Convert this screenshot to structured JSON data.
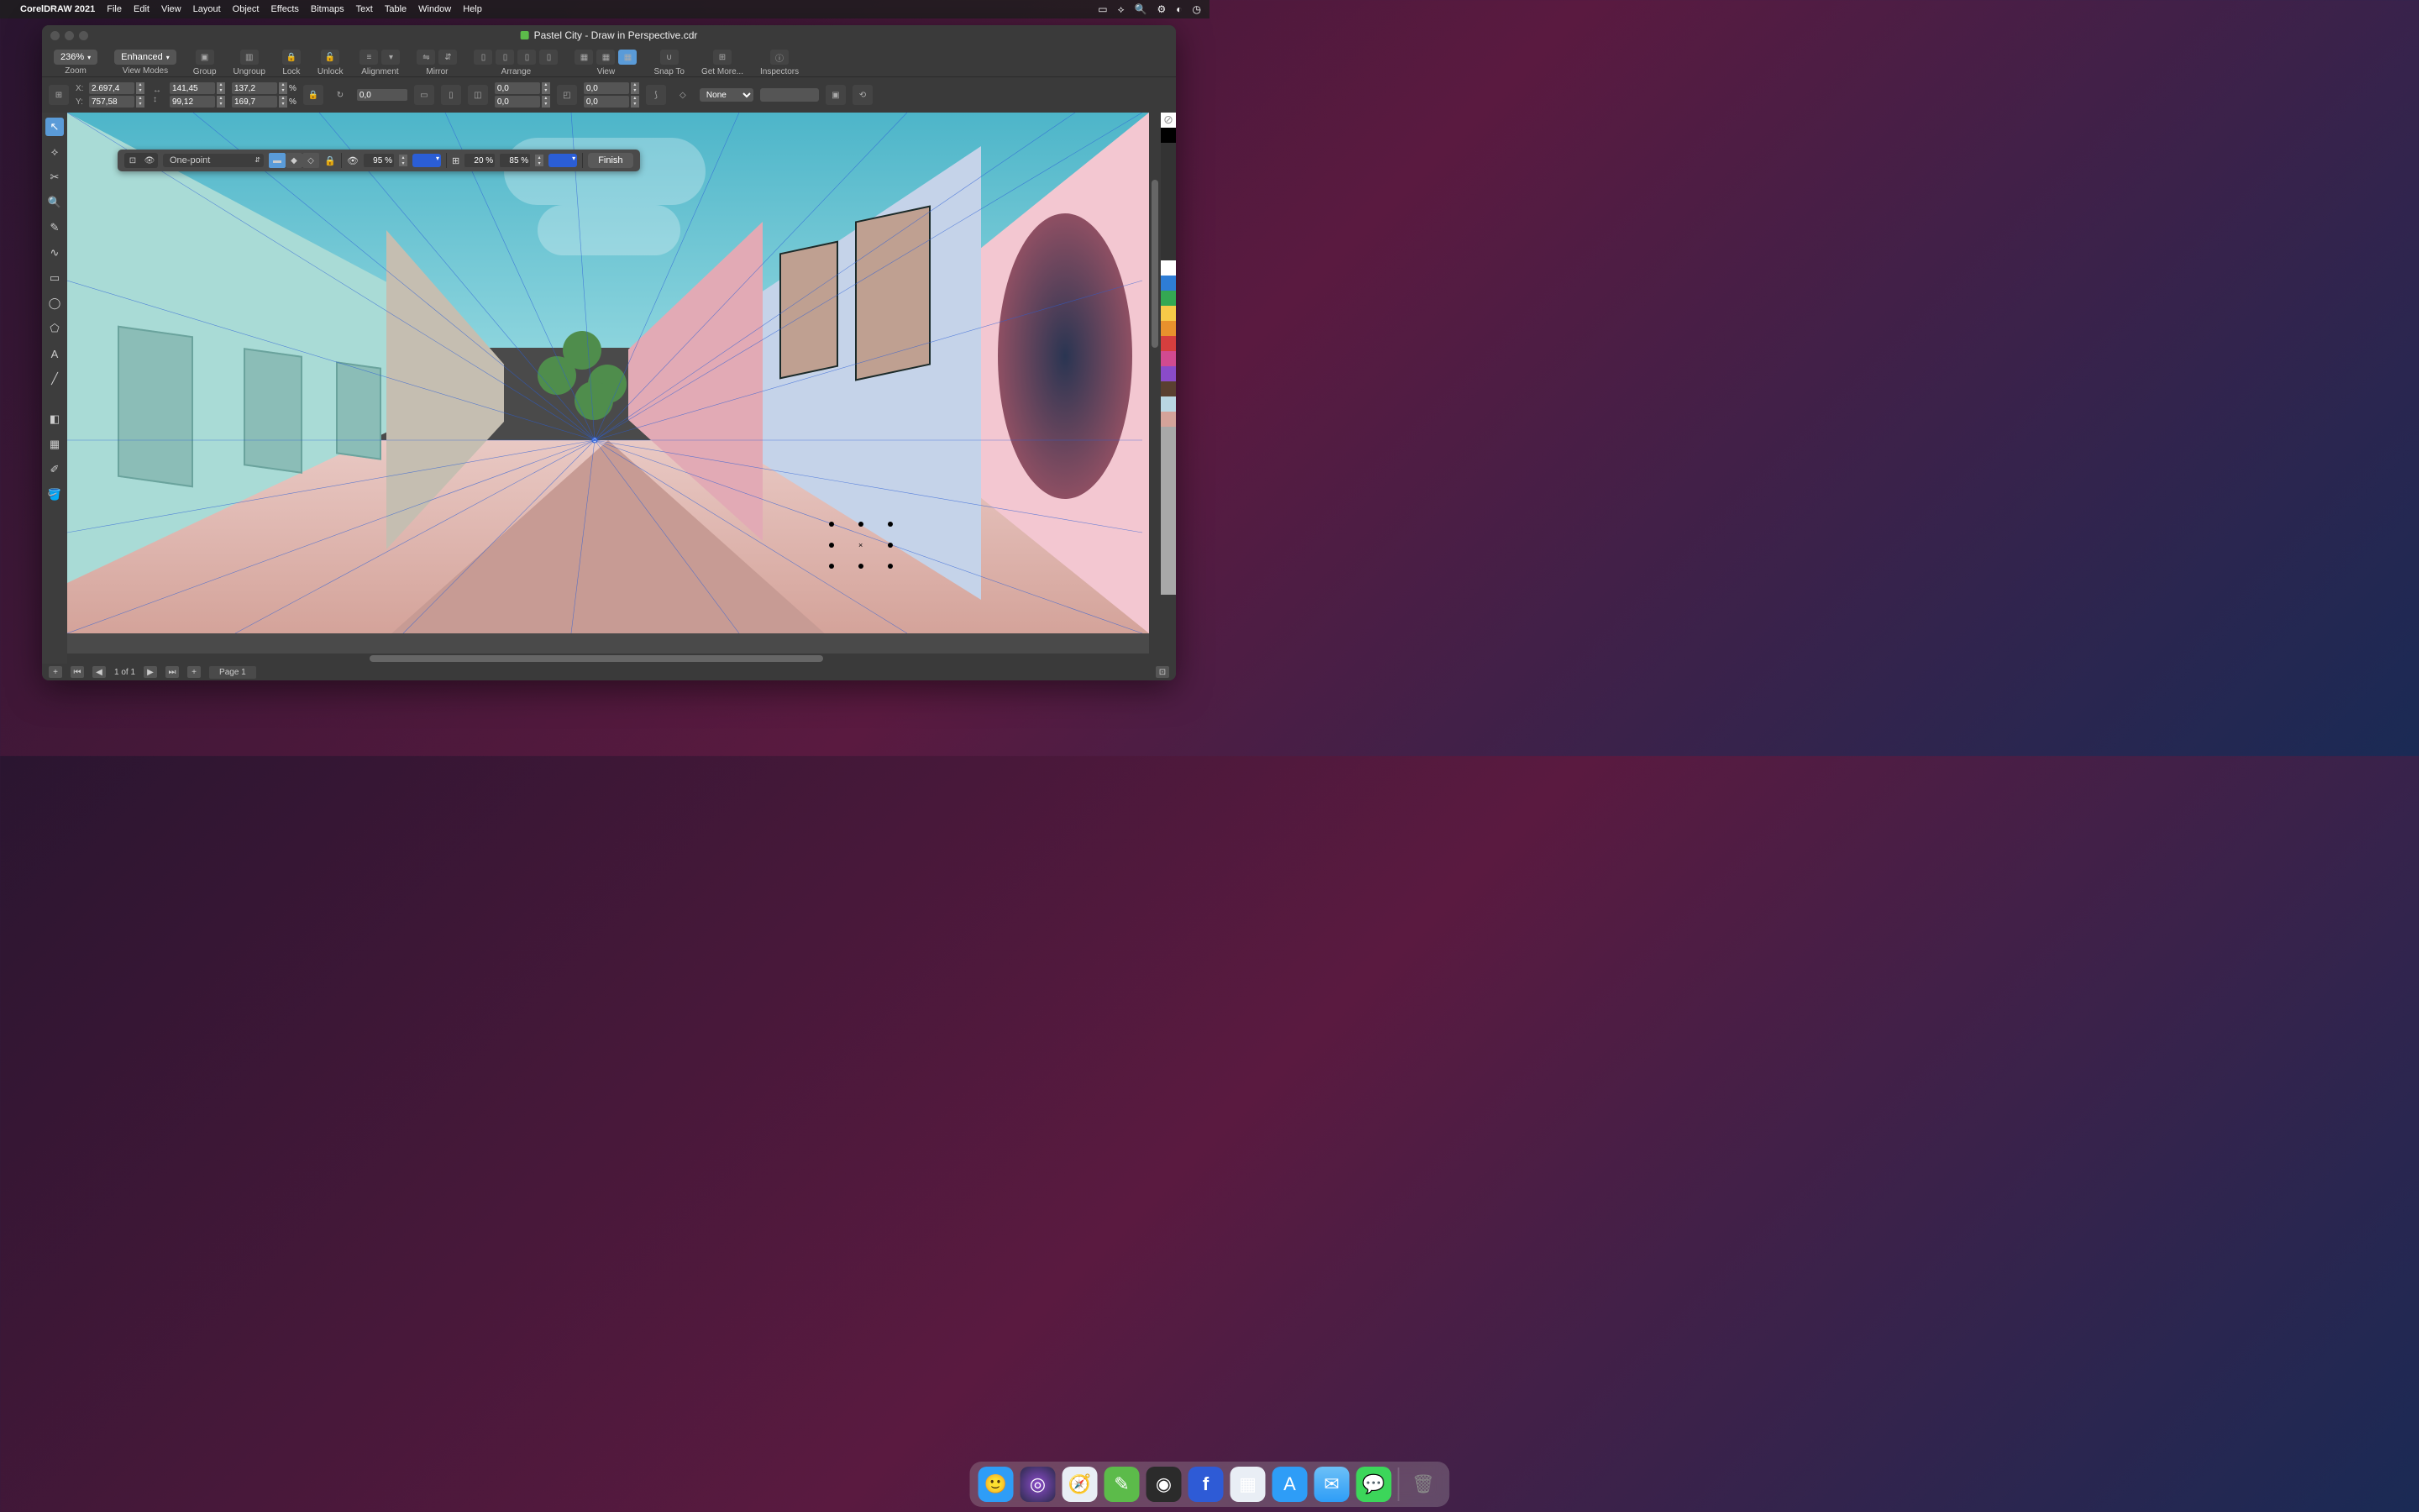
{
  "menubar": {
    "app_name": "CorelDRAW 2021",
    "items": [
      "File",
      "Edit",
      "View",
      "Layout",
      "Object",
      "Effects",
      "Bitmaps",
      "Text",
      "Table",
      "Window",
      "Help"
    ]
  },
  "window": {
    "title": "Pastel City - Draw in Perspective.cdr"
  },
  "toolbar": {
    "zoom_value": "236%",
    "view_mode": "Enhanced",
    "groups": [
      {
        "label": "Zoom"
      },
      {
        "label": "View Modes"
      },
      {
        "label": "Group"
      },
      {
        "label": "Ungroup"
      },
      {
        "label": "Lock"
      },
      {
        "label": "Unlock"
      },
      {
        "label": "Alignment"
      },
      {
        "label": "Mirror"
      },
      {
        "label": "Arrange"
      },
      {
        "label": "View"
      },
      {
        "label": "Snap To"
      },
      {
        "label": "Get More..."
      },
      {
        "label": "Inspectors"
      }
    ]
  },
  "propbar": {
    "x_label": "X:",
    "y_label": "Y:",
    "x_value": "2.697,4",
    "y_value": "757,58",
    "w_value": "141,45",
    "h_value": "99,12",
    "sx_value": "137,2",
    "sy_value": "169,7",
    "pct": "%",
    "angle": "0,0",
    "skew_x": "0,0",
    "skew_y": "0,0",
    "scale_x": "0,0",
    "scale_y": "0,0",
    "outline": "None"
  },
  "perspective": {
    "type": "One-point",
    "opacity1": "95 %",
    "opacity2": "20 %",
    "opacity3": "85 %",
    "finish": "Finish"
  },
  "toolbox": {
    "tools": [
      {
        "name": "pick-tool",
        "glyph": "↖"
      },
      {
        "name": "shape-tool",
        "glyph": "✎"
      },
      {
        "name": "crop-tool",
        "glyph": "✂"
      },
      {
        "name": "zoom-tool",
        "glyph": "🔍"
      },
      {
        "name": "freehand-tool",
        "glyph": "〰"
      },
      {
        "name": "curve-tool",
        "glyph": "∿"
      },
      {
        "name": "rectangle-tool",
        "glyph": "▭"
      },
      {
        "name": "ellipse-tool",
        "glyph": "◯"
      },
      {
        "name": "polygon-tool",
        "glyph": "⬠"
      },
      {
        "name": "text-tool",
        "glyph": "A"
      },
      {
        "name": "line-tool",
        "glyph": "╱"
      },
      {
        "name": "shadow-tool",
        "glyph": "◧"
      },
      {
        "name": "transparency-tool",
        "glyph": "▦"
      },
      {
        "name": "eyedropper-tool",
        "glyph": "✐"
      },
      {
        "name": "fill-tool",
        "glyph": "🪣"
      }
    ]
  },
  "statusbar": {
    "page_indicator": "1 of 1",
    "page_tab": "Page 1"
  },
  "palette_colors": [
    "#ffffff",
    "#000000",
    "#1a2a55",
    "#ffffff",
    "#2e7dd6",
    "#34a853",
    "#f7c948",
    "#e8912d",
    "#d63e3e",
    "#d14a90",
    "#8a4bc9",
    "#5a4030",
    "#b9d6e2",
    "#d4a39a",
    "#a8a8a8"
  ],
  "dock": {
    "apps": [
      {
        "name": "finder",
        "color": "#2e9df7",
        "glyph": "😀"
      },
      {
        "name": "siri",
        "color": "linear-gradient(#443,#226)",
        "glyph": "◎"
      },
      {
        "name": "safari",
        "color": "#e9eef5",
        "glyph": "🧭"
      },
      {
        "name": "coreldraw",
        "color": "#5cbb4a",
        "glyph": "✏"
      },
      {
        "name": "camera",
        "color": "#2b2b2b",
        "glyph": "◉"
      },
      {
        "name": "facebook",
        "color": "#2e5bd6",
        "glyph": "f"
      },
      {
        "name": "launchpad",
        "color": "#e9eef5",
        "glyph": "▦"
      },
      {
        "name": "appstore",
        "color": "#2e9df7",
        "glyph": "A"
      },
      {
        "name": "mail",
        "color": "#e9eef5",
        "glyph": "✉"
      },
      {
        "name": "messages",
        "color": "#3cd65a",
        "glyph": "💬"
      },
      {
        "name": "trash",
        "color": "#555",
        "glyph": "🗑"
      }
    ]
  }
}
